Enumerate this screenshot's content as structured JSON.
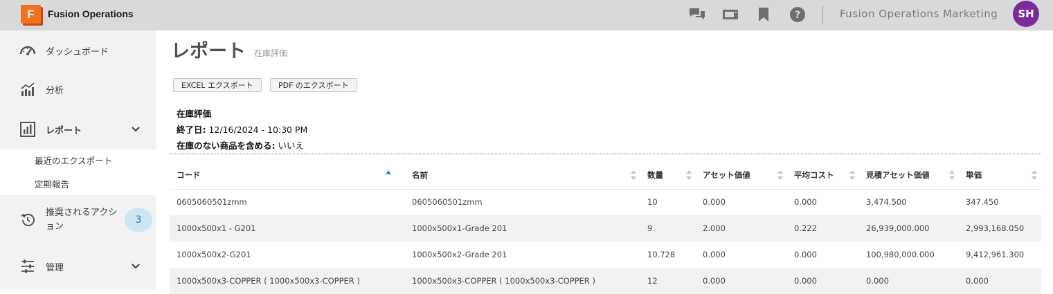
{
  "header": {
    "logo_letter": "F",
    "app_title": "Fusion Operations",
    "org_name": "Fusion Operations Marketing",
    "avatar_initials": "SH",
    "icons": [
      "chat-icon",
      "video-icon",
      "bookmark-icon",
      "help-icon"
    ]
  },
  "sidebar": {
    "items": [
      {
        "label": "ダッシュボード",
        "icon": "speedometer-icon"
      },
      {
        "label": "分析",
        "icon": "analytics-chart-icon"
      },
      {
        "label": "レポート",
        "icon": "report-bar-chart-icon"
      },
      {
        "label": "推奨されるアクション",
        "icon": "history-icon",
        "badge": "3"
      },
      {
        "label": "管理",
        "icon": "sliders-icon"
      }
    ],
    "sub_items": [
      "最近のエクスポート",
      "定期報告"
    ]
  },
  "page": {
    "title": "レポート",
    "subtitle": "在庫評価",
    "buttons": {
      "excel": "EXCEL エクスポート",
      "pdf": "PDF のエクスポート"
    },
    "info": {
      "report_name": "在庫評価",
      "end_date_label": "終了日:",
      "end_date_value": "12/16/2024 - 10:30 PM",
      "include_label": "在庫のない商品を含める:",
      "include_value": "いいえ"
    }
  },
  "table": {
    "columns": [
      "コード",
      "名前",
      "数量",
      "アセット価値",
      "平均コスト",
      "見積アセット価値",
      "単価"
    ],
    "rows": [
      [
        "0605060501zmm",
        "0605060501zmm",
        "10",
        "0.000",
        "0.000",
        "3,474.500",
        "347.450"
      ],
      [
        "1000x500x1 - G201",
        "1000x500x1-Grade 201",
        "9",
        "2.000",
        "0.222",
        "26,939,000.000",
        "2,993,168.050"
      ],
      [
        "1000x500x2-G201",
        "1000x500x2-Grade 201",
        "10.728",
        "0.000",
        "0.000",
        "100,980,000.000",
        "9,412,961.300"
      ],
      [
        "1000x500x3-COPPER ( 1000x500x3-COPPER )",
        "1000x500x3-COPPER ( 1000x500x3-COPPER )",
        "12",
        "0.000",
        "0.000",
        "0.000",
        "0.000"
      ]
    ]
  },
  "colors": {
    "accent": "#f36f21",
    "avatar": "#7b2a9b",
    "badge_bg": "#cde6f3",
    "sort_active": "#2a8fd0"
  }
}
